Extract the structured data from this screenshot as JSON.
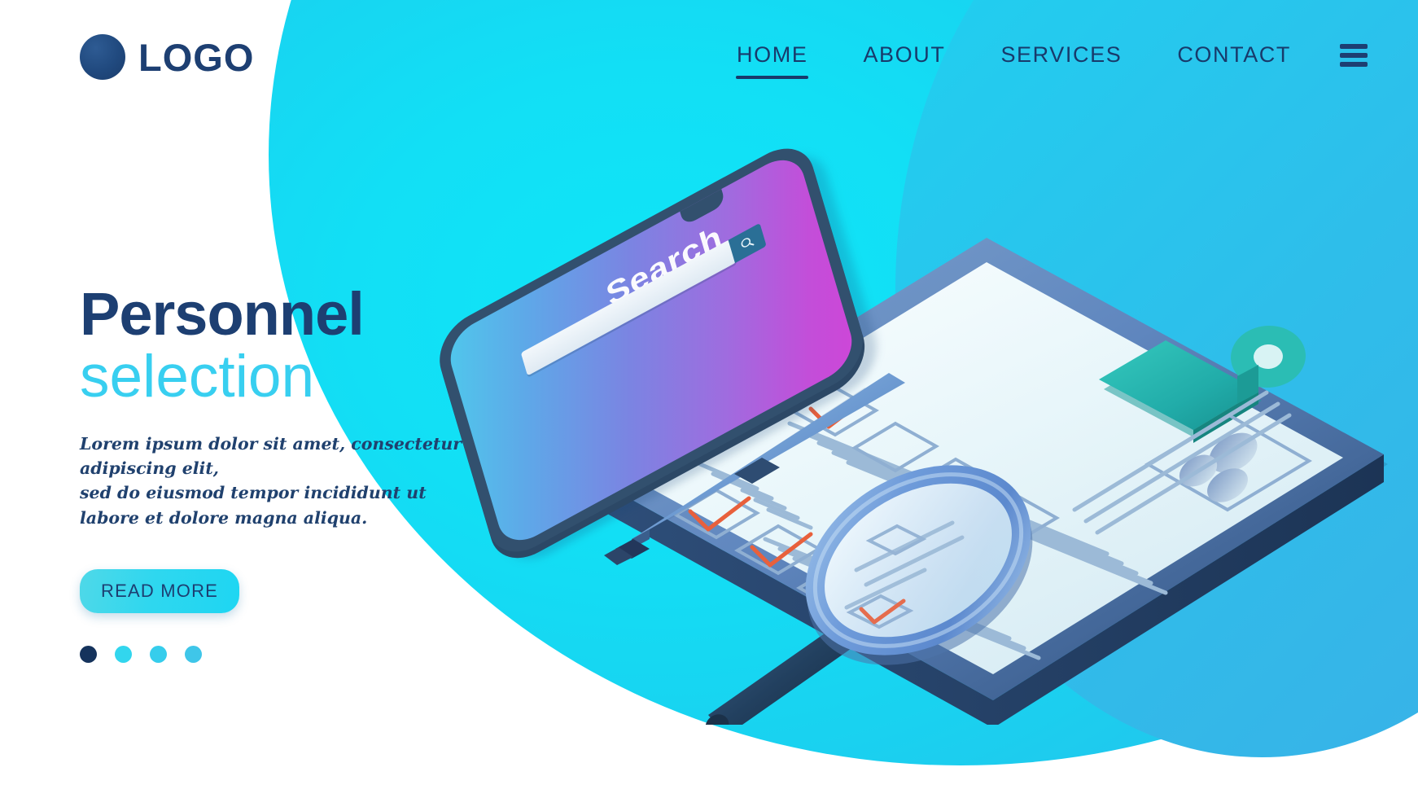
{
  "brand": {
    "logo_text": "LOGO",
    "logo_mark_icon": "circle-logo-icon",
    "logo_color": "#1d3f72"
  },
  "nav": {
    "items": [
      {
        "label": "HOME",
        "active": true
      },
      {
        "label": "ABOUT",
        "active": false
      },
      {
        "label": "SERVICES",
        "active": false
      },
      {
        "label": "CONTACT",
        "active": false
      }
    ],
    "menu_icon": "hamburger-menu-icon",
    "text_color": "#183a6b"
  },
  "hero": {
    "title_line1": "Personnel",
    "title_line2": "selection",
    "title_color": "#1d3f72",
    "subtitle_color": "#38CFF0",
    "paragraph_line1": "Lorem ipsum dolor sit amet, consectetur adipiscing elit,",
    "paragraph_line2": "sed do eiusmod tempor incididunt ut",
    "paragraph_line3": "labore et dolore magna aliqua.",
    "cta_label": "READ MORE",
    "cta_bg": "#2FD7EF",
    "cta_text_color": "#1d3f72"
  },
  "carousel": {
    "dots": [
      {
        "active": true,
        "color": "#15335c"
      },
      {
        "active": false,
        "color": "#32D6EE"
      },
      {
        "active": false,
        "color": "#36CDEC"
      },
      {
        "active": false,
        "color": "#3FC6E9"
      }
    ]
  },
  "illustration": {
    "background_blob_color": "#12DFF5",
    "background_blob_color_right": "#3BAFE6",
    "phone": {
      "screen_label": "Search",
      "search_icon": "magnifier-search-icon",
      "screen_gradient_from": "#4FC8EC",
      "screen_gradient_to": "#CE46D8",
      "frame_color": "#32506e",
      "notch_icon": "phone-notch"
    },
    "clipboard": {
      "clip_icon": "clipboard-clip-icon",
      "clip_color": "#25B3AE",
      "board_color": "#4F7BB5",
      "paper_color": "#E4F3F7",
      "avatar_icon": "person-avatar-icon",
      "checked_rows": 4,
      "unchecked_rows": 5,
      "check_color": "#E8603C",
      "text_line_color": "#8FAFD2"
    },
    "pen": {
      "icon": "pen-icon",
      "body_color": "#7FAEDC",
      "grip_color": "#2E4C72"
    },
    "magnifier": {
      "icon": "magnifying-glass-icon",
      "rim_color": "#6E9BDA",
      "handle_color": "#24405F",
      "lens_color": "#E9F6FA"
    }
  }
}
